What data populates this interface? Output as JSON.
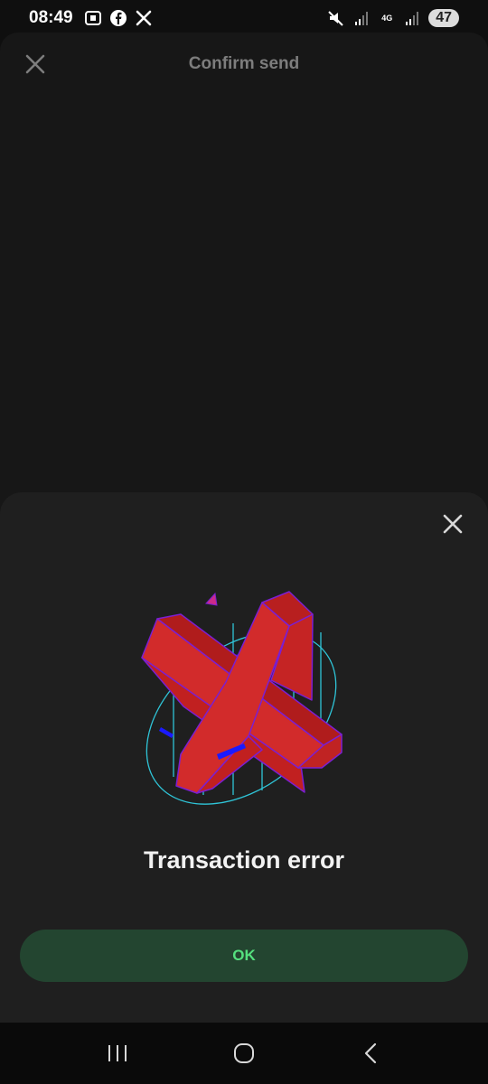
{
  "status_bar": {
    "time": "08:49",
    "network_label": "4G",
    "battery": "47",
    "left_icons": [
      "screenshot-icon",
      "facebook-icon",
      "x-icon"
    ],
    "right_icons": [
      "mute-icon",
      "signal-icon",
      "network-icon",
      "signal-icon"
    ]
  },
  "background_page": {
    "title": "Confirm send",
    "close_icon": "close-icon"
  },
  "sheet": {
    "title": "Transaction error",
    "ok_label": "OK",
    "close_icon": "close-icon",
    "illustration": "error-x-illustration"
  },
  "nav_bar": {
    "icons": [
      "recent-apps-icon",
      "home-icon",
      "back-icon"
    ]
  },
  "colors": {
    "ok_button_bg": "#234530",
    "ok_button_text": "#55e07e",
    "cross_red": "#d22b2b",
    "cross_outline": "#7b1fd1",
    "accent_blue": "#1a1aff",
    "globe_cyan": "#2fc5d8"
  }
}
